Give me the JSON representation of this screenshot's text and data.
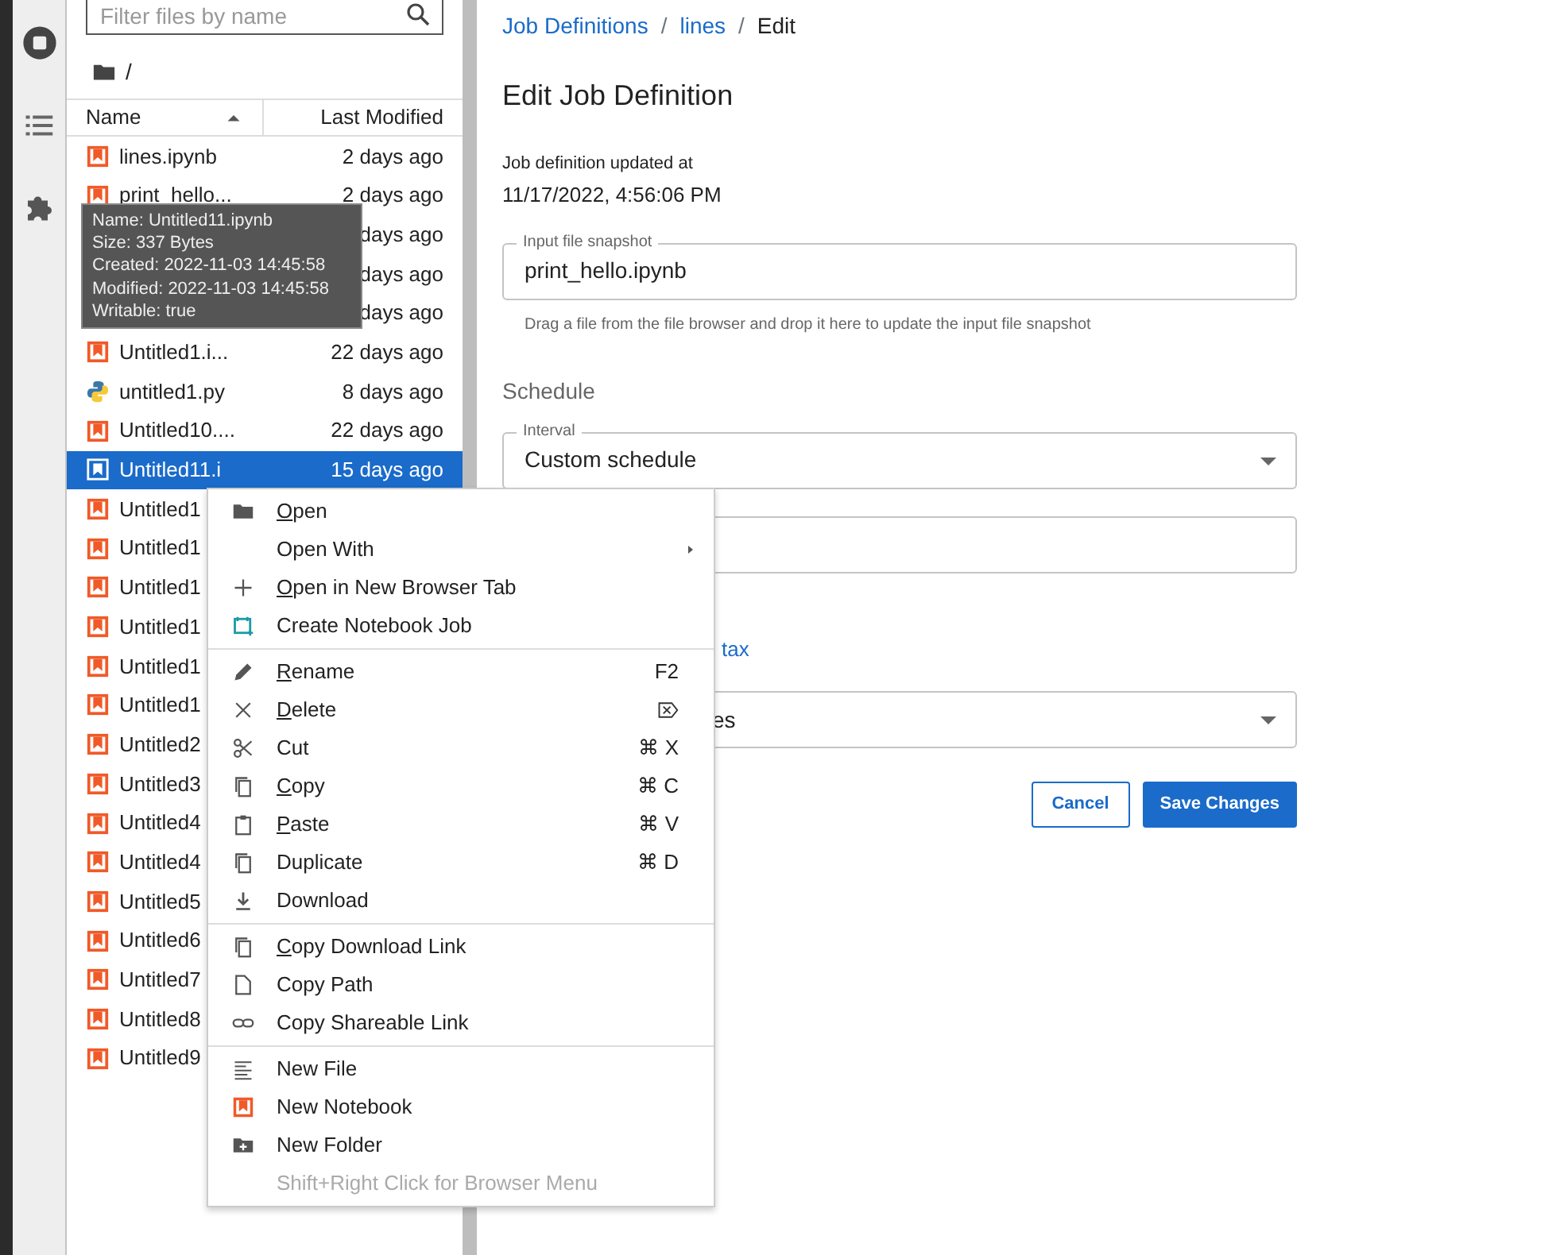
{
  "file_browser": {
    "filter": {
      "placeholder": "Filter files by name"
    },
    "path": "/",
    "columns": [
      {
        "label": "Name",
        "sort_ascending": true
      },
      {
        "label": "Last Modified"
      }
    ],
    "rows": [
      {
        "kind": "notebook",
        "name": "lines.ipynb",
        "modified": "2 days ago",
        "selected": false
      },
      {
        "kind": "notebook",
        "name": "print_hello...",
        "modified": "2 days ago",
        "selected": false
      },
      {
        "kind": "hidden",
        "modified": "days ago",
        "selected": false
      },
      {
        "kind": "hidden",
        "modified": "days ago",
        "selected": false
      },
      {
        "kind": "hidden",
        "modified": "days ago",
        "selected": false
      },
      {
        "kind": "notebook",
        "name": "Untitled1.i...",
        "modified": "22 days ago",
        "selected": false
      },
      {
        "kind": "python",
        "name": "untitled1.py",
        "modified": "8 days ago",
        "selected": false
      },
      {
        "kind": "notebook",
        "name": "Untitled10....",
        "modified": "22 days ago",
        "selected": false
      },
      {
        "kind": "notebook",
        "name": "Untitled11.i",
        "modified": "15 days ago",
        "selected": true
      },
      {
        "kind": "notebook",
        "name": "Untitled1",
        "selected": false
      },
      {
        "kind": "notebook",
        "name": "Untitled1",
        "selected": false
      },
      {
        "kind": "notebook",
        "name": "Untitled1",
        "selected": false
      },
      {
        "kind": "notebook",
        "name": "Untitled1",
        "selected": false
      },
      {
        "kind": "notebook",
        "name": "Untitled1",
        "selected": false
      },
      {
        "kind": "notebook",
        "name": "Untitled1",
        "selected": false
      },
      {
        "kind": "notebook",
        "name": "Untitled2",
        "selected": false
      },
      {
        "kind": "notebook",
        "name": "Untitled3",
        "selected": false
      },
      {
        "kind": "notebook",
        "name": "Untitled4",
        "selected": false
      },
      {
        "kind": "notebook",
        "name": "Untitled4",
        "selected": false
      },
      {
        "kind": "notebook",
        "name": "Untitled5",
        "selected": false
      },
      {
        "kind": "notebook",
        "name": "Untitled6",
        "selected": false
      },
      {
        "kind": "notebook",
        "name": "Untitled7",
        "selected": false
      },
      {
        "kind": "notebook",
        "name": "Untitled8",
        "selected": false
      },
      {
        "kind": "notebook",
        "name": "Untitled9",
        "selected": false
      }
    ]
  },
  "tooltip": [
    "Name: Untitled11.ipynb",
    "Size: 337 Bytes",
    "Created: 2022-11-03 14:45:58",
    "Modified: 2022-11-03 14:45:58",
    "Writable: true"
  ],
  "context_menu": [
    [
      {
        "label": "Open",
        "mnemonic": true
      },
      {
        "label": "Open With",
        "submenu": true
      },
      {
        "label": "Open in New Browser Tab",
        "mnemonic": true
      },
      {
        "label": "Create Notebook Job"
      }
    ],
    [
      {
        "label": "Rename",
        "mnemonic": true,
        "shortcut": "F2"
      },
      {
        "label": "Delete",
        "mnemonic": true,
        "shortcut_key_icon": true
      },
      {
        "label": "Cut",
        "shortcut": "⌘ X"
      },
      {
        "label": "Copy",
        "mnemonic": true,
        "shortcut": "⌘ C"
      },
      {
        "label": "Paste",
        "mnemonic": true,
        "shortcut": "⌘ V"
      },
      {
        "label": "Duplicate",
        "shortcut": "⌘ D"
      },
      {
        "label": "Download"
      }
    ],
    [
      {
        "label": "Copy Download Link",
        "mnemonic": true
      },
      {
        "label": "Copy Path"
      },
      {
        "label": "Copy Shareable Link"
      }
    ],
    [
      {
        "label": "New File"
      },
      {
        "label": "New Notebook"
      },
      {
        "label": "New Folder"
      },
      {
        "label": "Shift+Right Click for Browser Menu",
        "disabled": true
      }
    ]
  ],
  "editor": {
    "breadcrumb": [
      {
        "label": "Job Definitions",
        "link": true
      },
      {
        "separator": "/",
        "label": "lines",
        "link": true
      },
      {
        "separator": "/",
        "label": "Edit",
        "link": false
      }
    ],
    "title": "Edit Job Definition",
    "updated_label": "Job definition updated at",
    "updated_value": "11/17/2022, 4:56:06 PM",
    "snapshot": {
      "label": "Input file snapshot",
      "value": "print_hello.ipynb",
      "help": "Drag a file from the file browser and drop it here to update the input file snapshot"
    },
    "schedule_heading": "Schedule",
    "interval": {
      "label": "Interval",
      "value": "Custom schedule"
    },
    "syntax_link": "tax",
    "select_value": "es",
    "buttons": [
      {
        "label": "Cancel",
        "kind": "secondary"
      },
      {
        "label": "Save Changes",
        "kind": "primary"
      }
    ]
  }
}
